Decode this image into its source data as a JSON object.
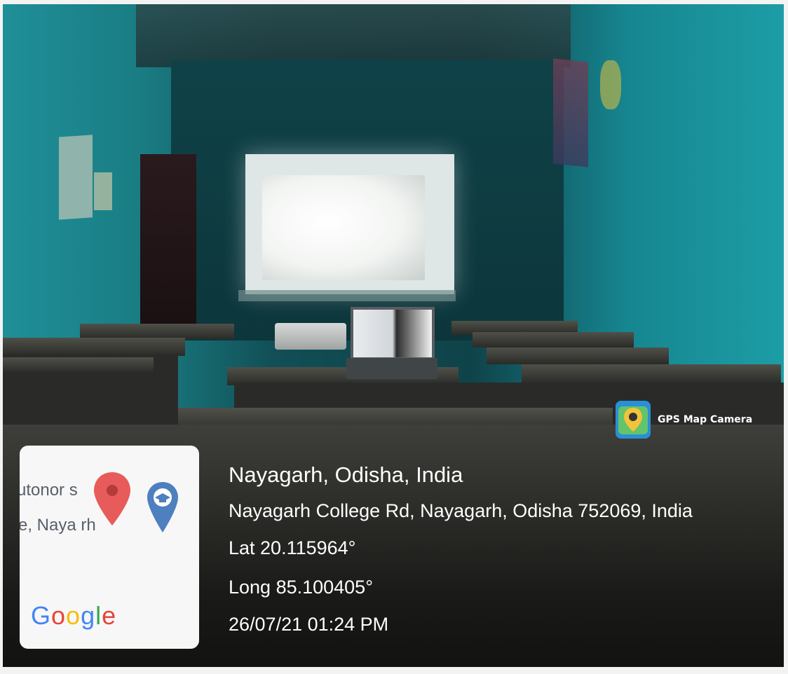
{
  "overlay": {
    "location_title": "Nayagarh, Odisha, India",
    "address": "Nayagarh College Rd, Nayagarh, Odisha 752069, India",
    "latitude": "Lat 20.115964°",
    "longitude": "Long 85.100405°",
    "datetime": "26/07/21 01:24 PM"
  },
  "app_badge": {
    "label": "GPS Map Camera",
    "icon": "gps-map-camera-icon"
  },
  "map_thumbnail": {
    "place_text_line1": "utonor  s",
    "place_text_line2": "e, Naya  rh",
    "map_provider": "Google",
    "pin_color": "#e85b5b",
    "edu_pin_color": "#4e7fbf"
  }
}
